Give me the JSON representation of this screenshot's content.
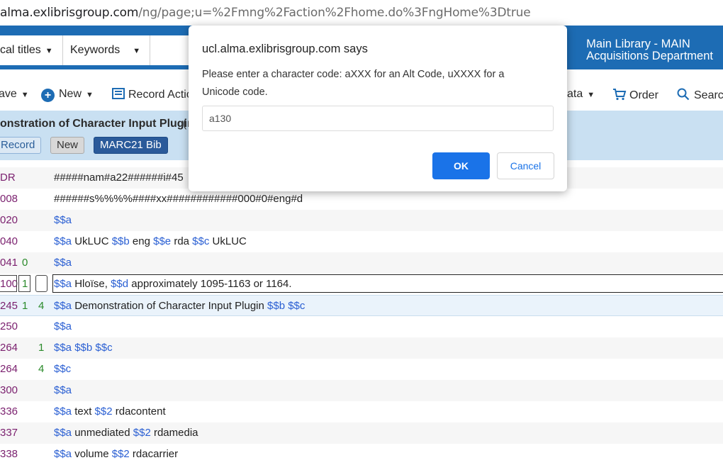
{
  "browser": {
    "url_host": "alma.exlibrisgroup.com",
    "url_path": "/ng/page;u=%2Fmng%2Faction%2Fhome.do%3FngHome%3Dtrue"
  },
  "search": {
    "scope_label": "cal titles",
    "type_label": "Keywords"
  },
  "library": {
    "line1": "Main Library - MAIN",
    "line2": "Acquisitions Department"
  },
  "toolbar": {
    "save": "ave",
    "new": "New",
    "record_actions": "Record Actio",
    "data": "ata",
    "order": "Order",
    "search": "Searc"
  },
  "record": {
    "title": "onstration of Character Input Plugin",
    "paren": "(",
    "badge_record": "Record",
    "badge_new": "New",
    "badge_marc": "MARC21 Bib"
  },
  "fields": [
    {
      "tag": "DR",
      "ind1": "",
      "ind2": "",
      "parts": [
        [
          "t",
          "#####nam#a22######i#45"
        ]
      ]
    },
    {
      "tag": "008",
      "ind1": "",
      "ind2": "",
      "parts": [
        [
          "t",
          "######s%%%%####xx############000#0#eng#d"
        ]
      ]
    },
    {
      "tag": "020",
      "ind1": "",
      "ind2": "",
      "parts": [
        [
          "s",
          "$$a"
        ]
      ]
    },
    {
      "tag": "040",
      "ind1": "",
      "ind2": "",
      "parts": [
        [
          "s",
          "$$a"
        ],
        [
          "t",
          " UkLUC "
        ],
        [
          "s",
          "$$b"
        ],
        [
          "t",
          " eng "
        ],
        [
          "s",
          "$$e"
        ],
        [
          "t",
          " rda "
        ],
        [
          "s",
          "$$c"
        ],
        [
          "t",
          " UkLUC"
        ]
      ]
    },
    {
      "tag": "041",
      "ind1": "0",
      "ind2": "",
      "parts": [
        [
          "s",
          "$$a"
        ]
      ]
    },
    {
      "tag": "100",
      "ind1": "1",
      "ind2": "",
      "parts": [
        [
          "s",
          "$$a"
        ],
        [
          "t",
          " Hloïse, "
        ],
        [
          "s",
          "$$d"
        ],
        [
          "t",
          " approximately 1095-1163 or 1164."
        ]
      ]
    },
    {
      "tag": "245",
      "ind1": "1",
      "ind2": "4",
      "parts": [
        [
          "s",
          "$$a"
        ],
        [
          "t",
          " Demonstration of Character Input Plugin  "
        ],
        [
          "s",
          "$$b"
        ],
        [
          "t",
          "  "
        ],
        [
          "s",
          "$$c"
        ]
      ]
    },
    {
      "tag": "250",
      "ind1": "",
      "ind2": "",
      "parts": [
        [
          "s",
          "$$a"
        ]
      ]
    },
    {
      "tag": "264",
      "ind1": "",
      "ind2": "1",
      "parts": [
        [
          "s",
          "$$a"
        ],
        [
          "t",
          "  "
        ],
        [
          "s",
          "$$b"
        ],
        [
          "t",
          "  "
        ],
        [
          "s",
          "$$c"
        ]
      ]
    },
    {
      "tag": "264",
      "ind1": "",
      "ind2": "4",
      "parts": [
        [
          "s",
          "$$c"
        ]
      ]
    },
    {
      "tag": "300",
      "ind1": "",
      "ind2": "",
      "parts": [
        [
          "s",
          "$$a"
        ]
      ]
    },
    {
      "tag": "336",
      "ind1": "",
      "ind2": "",
      "parts": [
        [
          "s",
          "$$a"
        ],
        [
          "t",
          " text "
        ],
        [
          "s",
          "$$2"
        ],
        [
          "t",
          " rdacontent"
        ]
      ]
    },
    {
      "tag": "337",
      "ind1": "",
      "ind2": "",
      "parts": [
        [
          "s",
          "$$a"
        ],
        [
          "t",
          " unmediated "
        ],
        [
          "s",
          "$$2"
        ],
        [
          "t",
          " rdamedia"
        ]
      ]
    },
    {
      "tag": "338",
      "ind1": "",
      "ind2": "",
      "parts": [
        [
          "s",
          "$$a"
        ],
        [
          "t",
          " volume "
        ],
        [
          "s",
          "$$2"
        ],
        [
          "t",
          " rdacarrier"
        ]
      ]
    }
  ],
  "dialog": {
    "title": "ucl.alma.exlibrisgroup.com says",
    "message": "Please enter a character code: aXXX for an Alt Code, uXXXX for a Unicode code.",
    "input_value": "a130",
    "ok": "OK",
    "cancel": "Cancel"
  },
  "colors": {
    "alma_blue": "#1d6cb4",
    "header_band": "#c9e0f2",
    "subfield_blue": "#2a5fd3",
    "tag_purple": "#7a1f6e",
    "indicator_green": "#2a8a2a",
    "ok_button": "#1a73e8"
  }
}
